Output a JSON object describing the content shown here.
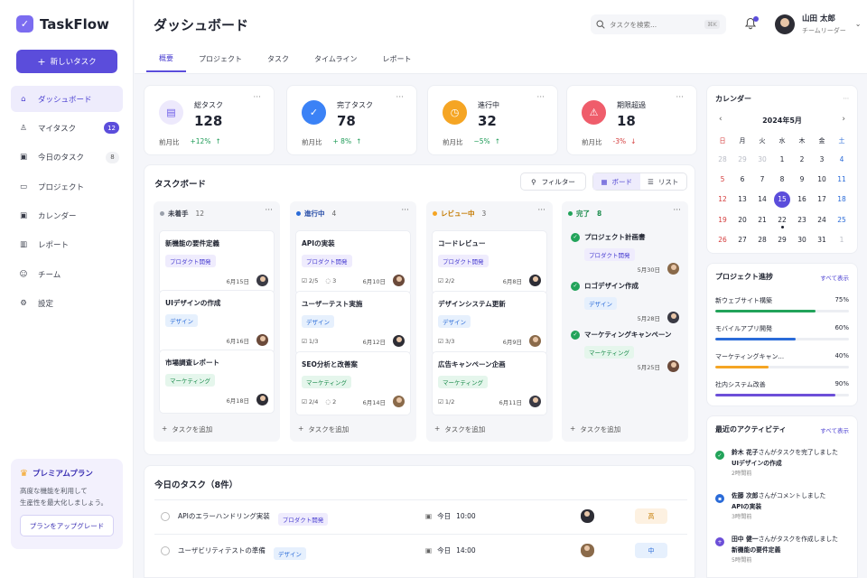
{
  "app": {
    "name": "TaskFlow",
    "new_task": "新しいタスク"
  },
  "nav": [
    {
      "label": "ダッシュボード",
      "icon": "home-icon",
      "badge": ""
    },
    {
      "label": "マイタスク",
      "icon": "user-icon",
      "badge": "12"
    },
    {
      "label": "今日のタスク",
      "icon": "calendar-icon",
      "badge": "8"
    },
    {
      "label": "プロジェクト",
      "icon": "folder-icon",
      "badge": ""
    },
    {
      "label": "カレンダー",
      "icon": "calendar-icon",
      "badge": ""
    },
    {
      "label": "レポート",
      "icon": "chart-icon",
      "badge": ""
    },
    {
      "label": "チーム",
      "icon": "team-icon",
      "badge": ""
    },
    {
      "label": "設定",
      "icon": "gear-icon",
      "badge": ""
    }
  ],
  "premium": {
    "title": "プレミアムプラン",
    "text": "高度な機能を利用して\n生産性を最大化しましょう。",
    "button": "プランをアップグレード"
  },
  "header": {
    "title": "ダッシュボード",
    "search_placeholder": "タスクを検索...",
    "shortcut": "⌘K",
    "user_name": "山田 太郎",
    "user_role": "チームリーダー",
    "tabs": [
      "概要",
      "プロジェクト",
      "タスク",
      "タイムライン",
      "レポート"
    ]
  },
  "stats": [
    {
      "label": "総タスク",
      "value": "128",
      "compare": "前月比",
      "change": "+12%",
      "dir": "up",
      "color": "#ede9fc",
      "icon_color": "#6c5ce7"
    },
    {
      "label": "完了タスク",
      "value": "78",
      "compare": "前月比",
      "change": "+ 8%",
      "dir": "up",
      "color": "#3b82f6",
      "icon_color": "#ffffff"
    },
    {
      "label": "進行中",
      "value": "32",
      "compare": "前月比",
      "change": "~5%",
      "dir": "up",
      "color": "#f5a524",
      "icon_color": "#ffffff"
    },
    {
      "label": "期限超過",
      "value": "18",
      "compare": "前月比",
      "change": "-3%",
      "dir": "down",
      "color": "#ef5d6b",
      "icon_color": "#ffffff"
    }
  ],
  "board": {
    "title": "タスクボード",
    "filter": "フィルター",
    "view_board": "ボード",
    "view_list": "リスト",
    "add_task": "タスクを追加",
    "columns": [
      {
        "name": "未着手",
        "count": "12",
        "color": "#9aa0ab",
        "text_color": "#3b3f4c",
        "cards": [
          {
            "title": "新機能の要件定義",
            "tag": "プロダクト開発",
            "tag_class": "purple",
            "checks": "",
            "comments": "",
            "date": "6月15日",
            "done": false
          },
          {
            "title": "UIデザインの作成",
            "tag": "デザイン",
            "tag_class": "blue",
            "checks": "",
            "comments": "",
            "date": "6月16日",
            "done": false
          },
          {
            "title": "市場調査レポート",
            "tag": "マーケティング",
            "tag_class": "green",
            "checks": "",
            "comments": "",
            "date": "6月18日",
            "done": false
          }
        ]
      },
      {
        "name": "進行中",
        "count": "4",
        "color": "#2a6bd8",
        "text_color": "#2a4fa8",
        "cards": [
          {
            "title": "APIの実装",
            "tag": "プロダクト開発",
            "tag_class": "purple",
            "checks": "2/5",
            "comments": "3",
            "date": "6月10日",
            "done": false
          },
          {
            "title": "ユーザーテスト実施",
            "tag": "デザイン",
            "tag_class": "blue",
            "checks": "1/3",
            "comments": "",
            "date": "6月12日",
            "done": false
          },
          {
            "title": "SEO分析と改善案",
            "tag": "マーケティング",
            "tag_class": "green",
            "checks": "2/4",
            "comments": "2",
            "date": "6月14日",
            "done": false
          }
        ]
      },
      {
        "name": "レビュー中",
        "count": "3",
        "color": "#f5a524",
        "text_color": "#c47a00",
        "cards": [
          {
            "title": "コードレビュー",
            "tag": "プロダクト開発",
            "tag_class": "purple",
            "checks": "2/2",
            "comments": "",
            "date": "6月8日",
            "done": false
          },
          {
            "title": "デザインシステム更新",
            "tag": "デザイン",
            "tag_class": "blue",
            "checks": "3/3",
            "comments": "",
            "date": "6月9日",
            "done": false
          },
          {
            "title": "広告キャンペーン企画",
            "tag": "マーケティング",
            "tag_class": "green",
            "checks": "1/2",
            "comments": "",
            "date": "6月11日",
            "done": false
          }
        ]
      },
      {
        "name": "完了",
        "count": "8",
        "color": "#22a35a",
        "text_color": "#1c8c4d",
        "cards": [
          {
            "title": "プロジェクト計画書",
            "tag": "プロダクト開発",
            "tag_class": "purple",
            "checks": "",
            "comments": "",
            "date": "5月30日",
            "done": true
          },
          {
            "title": "ロゴデザイン作成",
            "tag": "デザイン",
            "tag_class": "blue",
            "checks": "",
            "comments": "",
            "date": "5月28日",
            "done": true
          },
          {
            "title": "マーケティングキャンペーン",
            "tag": "マーケティング",
            "tag_class": "green",
            "checks": "",
            "comments": "",
            "date": "5月25日",
            "done": true
          }
        ]
      }
    ]
  },
  "today": {
    "title": "今日のタスク（8件）",
    "rows": [
      {
        "title": "APIのエラーハンドリング実装",
        "tag": "プロダクト開発",
        "tag_class": "purple",
        "day": "今日",
        "time": "10:00",
        "priority": "高",
        "p_bg": "#fdf1e1",
        "p_color": "#c47a00"
      },
      {
        "title": "ユーザビリティテストの準備",
        "tag": "デザイン",
        "tag_class": "blue",
        "day": "今日",
        "time": "14:00",
        "priority": "中",
        "p_bg": "#e6f0fd",
        "p_color": "#2a6bd8"
      }
    ]
  },
  "calendar": {
    "title": "カレンダー",
    "month": "2024年5月",
    "weekdays": [
      "日",
      "月",
      "火",
      "水",
      "木",
      "金",
      "土"
    ],
    "days": [
      [
        "28",
        "29",
        "30",
        "1",
        "2",
        "3",
        "4"
      ],
      [
        "5",
        "6",
        "7",
        "8",
        "9",
        "10",
        "11"
      ],
      [
        "12",
        "13",
        "14",
        "15",
        "16",
        "17",
        "18"
      ],
      [
        "19",
        "20",
        "21",
        "22",
        "23",
        "24",
        "25"
      ],
      [
        "26",
        "27",
        "28",
        "29",
        "30",
        "31",
        "1"
      ]
    ]
  },
  "progress": {
    "title": "プロジェクト進捗",
    "link": "すべて表示",
    "items": [
      {
        "name": "新ウェブサイト構築",
        "percent": 75,
        "label": "75%",
        "color": "#22a35a"
      },
      {
        "name": "モバイルアプリ開発",
        "percent": 60,
        "label": "60%",
        "color": "#2a6bd8"
      },
      {
        "name": "マーケティングキャン...",
        "percent": 40,
        "label": "40%",
        "color": "#f5a524"
      },
      {
        "name": "社内システム改善",
        "percent": 90,
        "label": "90%",
        "color": "#6c4fd8"
      }
    ]
  },
  "activity": {
    "title": "最近のアクティビティ",
    "link": "すべて表示",
    "items": [
      {
        "user": "鈴木 花子",
        "action": "さんがタスクを完了しました",
        "target": "UIデザインの作成",
        "time": "2時間前",
        "color": "#22a35a",
        "icon": "check-icon"
      },
      {
        "user": "佐藤 次郎",
        "action": "さんがコメントしました",
        "target": "APIの実装",
        "time": "3時間前",
        "color": "#2a6bd8",
        "icon": "comment-icon"
      },
      {
        "user": "田中 健一",
        "action": "さんがタスクを作成しました",
        "target": "新機能の要件定義",
        "time": "5時間前",
        "color": "#6c4fd8",
        "icon": "plus-icon"
      }
    ]
  }
}
